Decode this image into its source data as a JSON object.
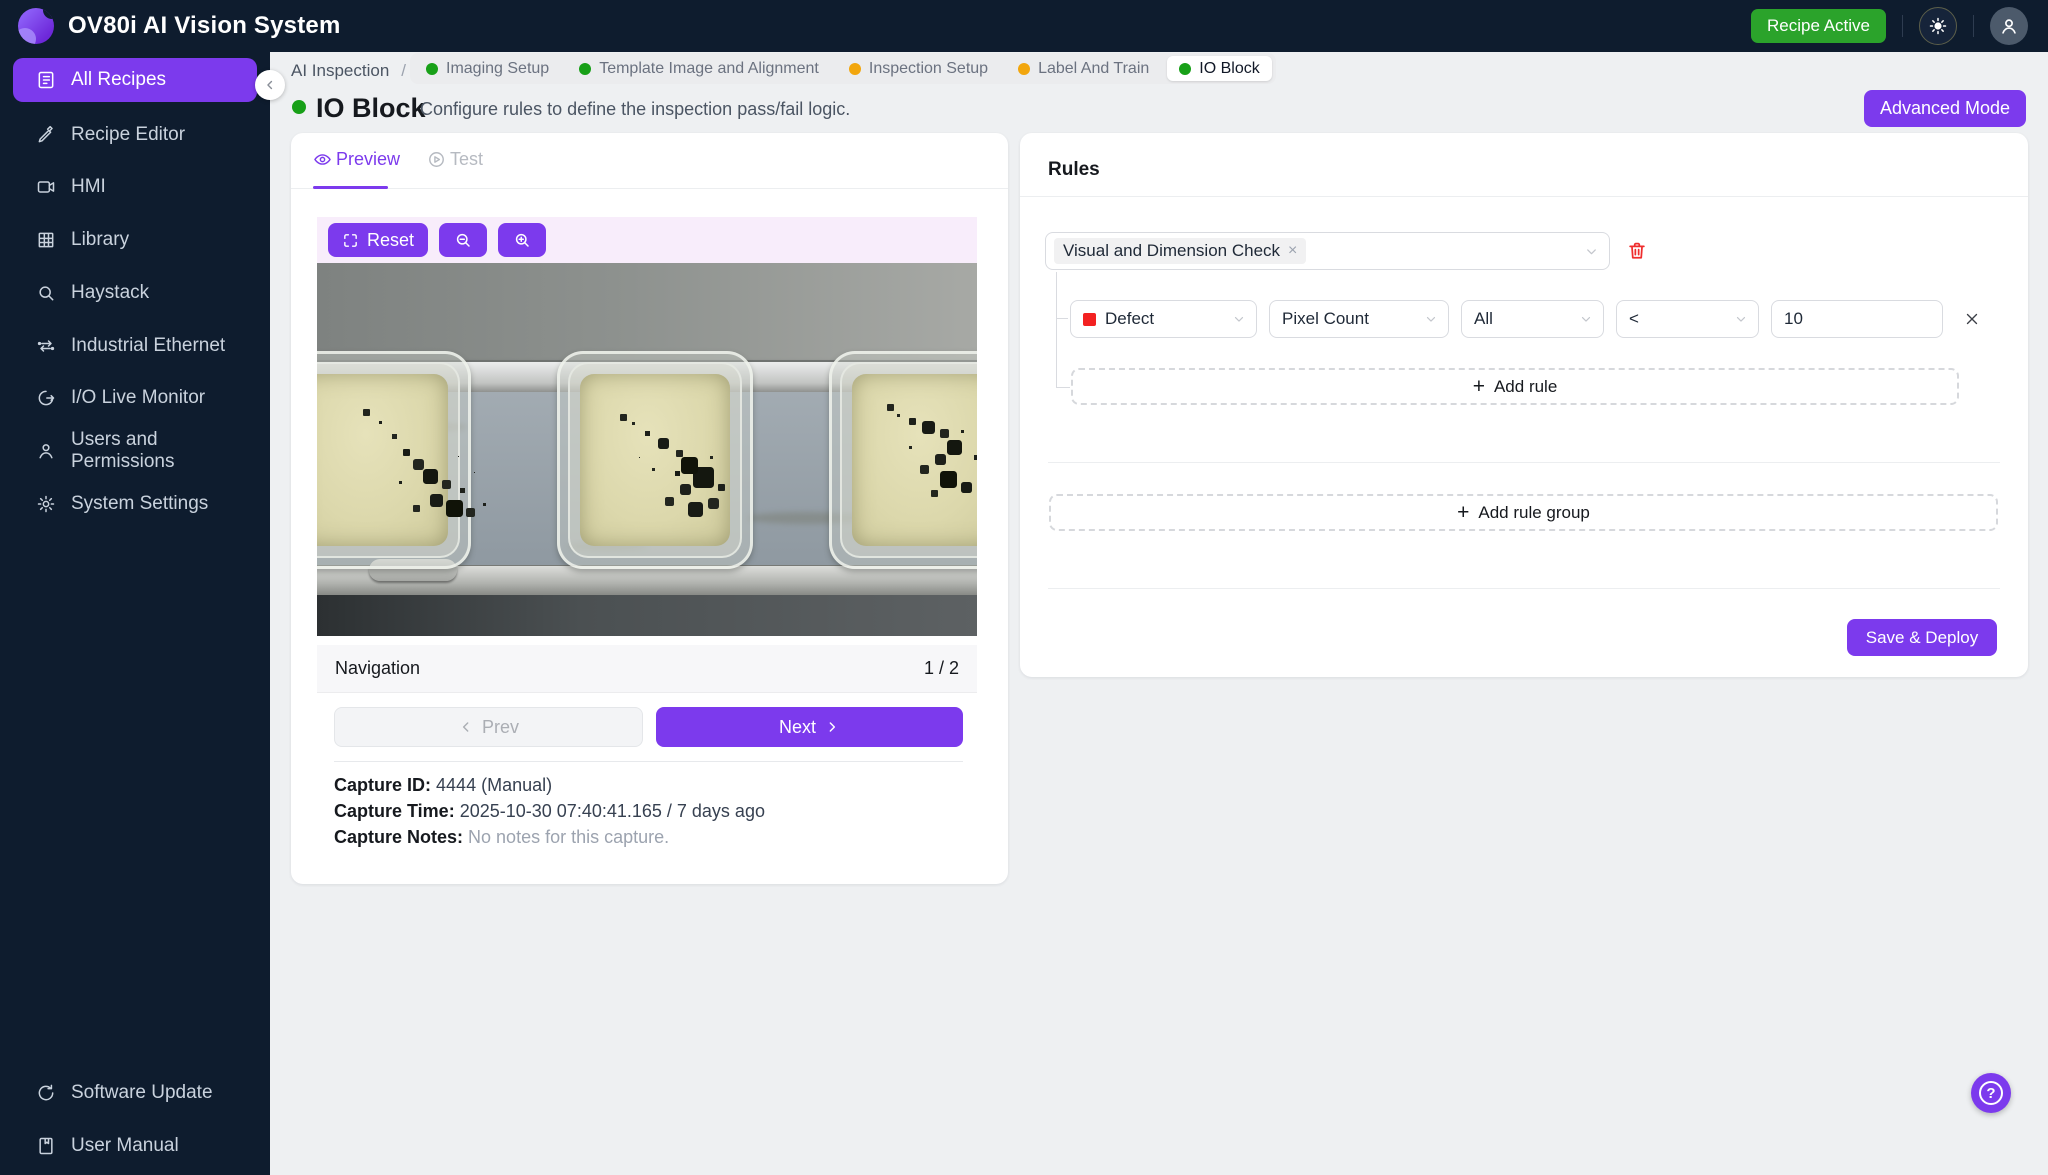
{
  "app": {
    "title": "OV80i AI Vision System",
    "recipe_badge": "Recipe Active"
  },
  "colors": {
    "accent_purple": "#7c3aed",
    "sidebar_bg": "#0e1c2e",
    "badge_green": "#2ba32b",
    "dot_green": "#18a018",
    "dot_orange": "#f2a60d",
    "danger_red": "#ef2d2d",
    "defect_red": "#f32121",
    "toolbar_pink": "#f8edfb"
  },
  "sidebar": {
    "items": [
      {
        "label": "All Recipes",
        "active": true
      },
      {
        "label": "Recipe Editor",
        "active": false
      },
      {
        "label": "HMI",
        "active": false
      },
      {
        "label": "Library",
        "active": false
      },
      {
        "label": "Haystack",
        "active": false
      },
      {
        "label": "Industrial Ethernet",
        "active": false
      },
      {
        "label": "I/O Live Monitor",
        "active": false
      },
      {
        "label": "Users and Permissions",
        "active": false
      },
      {
        "label": "System Settings",
        "active": false
      }
    ],
    "footer_items": [
      {
        "label": "Software Update"
      },
      {
        "label": "User Manual"
      }
    ]
  },
  "breadcrumb": {
    "root": "AI Inspection",
    "separator": "/",
    "steps": [
      {
        "label": "Imaging Setup",
        "status": "complete"
      },
      {
        "label": "Template Image and Alignment",
        "status": "complete"
      },
      {
        "label": "Inspection Setup",
        "status": "in-progress"
      },
      {
        "label": "Label And Train",
        "status": "in-progress"
      },
      {
        "label": "IO Block",
        "status": "active"
      }
    ]
  },
  "page": {
    "title": "IO Block",
    "subtitle": "Configure rules to define the inspection pass/fail logic.",
    "advanced_mode_label": "Advanced Mode"
  },
  "preview_panel": {
    "tabs": {
      "preview": "Preview",
      "test": "Test"
    },
    "toolbar": {
      "reset_label": "Reset"
    },
    "navigation": {
      "title": "Navigation",
      "page_indicator": "1 / 2",
      "prev_label": "Prev",
      "next_label": "Next"
    },
    "capture": {
      "id_label": "Capture ID:",
      "id_value": "4444 (Manual)",
      "time_label": "Capture Time:",
      "time_value": "2025-10-30 07:40:41.165 / 7 days ago",
      "notes_label": "Capture Notes:",
      "notes_value": "No notes for this capture."
    }
  },
  "rules_panel": {
    "title": "Rules",
    "plus": "+",
    "group_tag": "Visual and Dimension Check",
    "tag_remove": "×",
    "rule": {
      "defect_class": "Defect",
      "metric": "Pixel Count",
      "scope": "All",
      "operator": "<",
      "threshold": "10"
    },
    "add_rule_label": "Add rule",
    "add_rule_group_label": "Add rule group",
    "save_label": "Save & Deploy"
  }
}
